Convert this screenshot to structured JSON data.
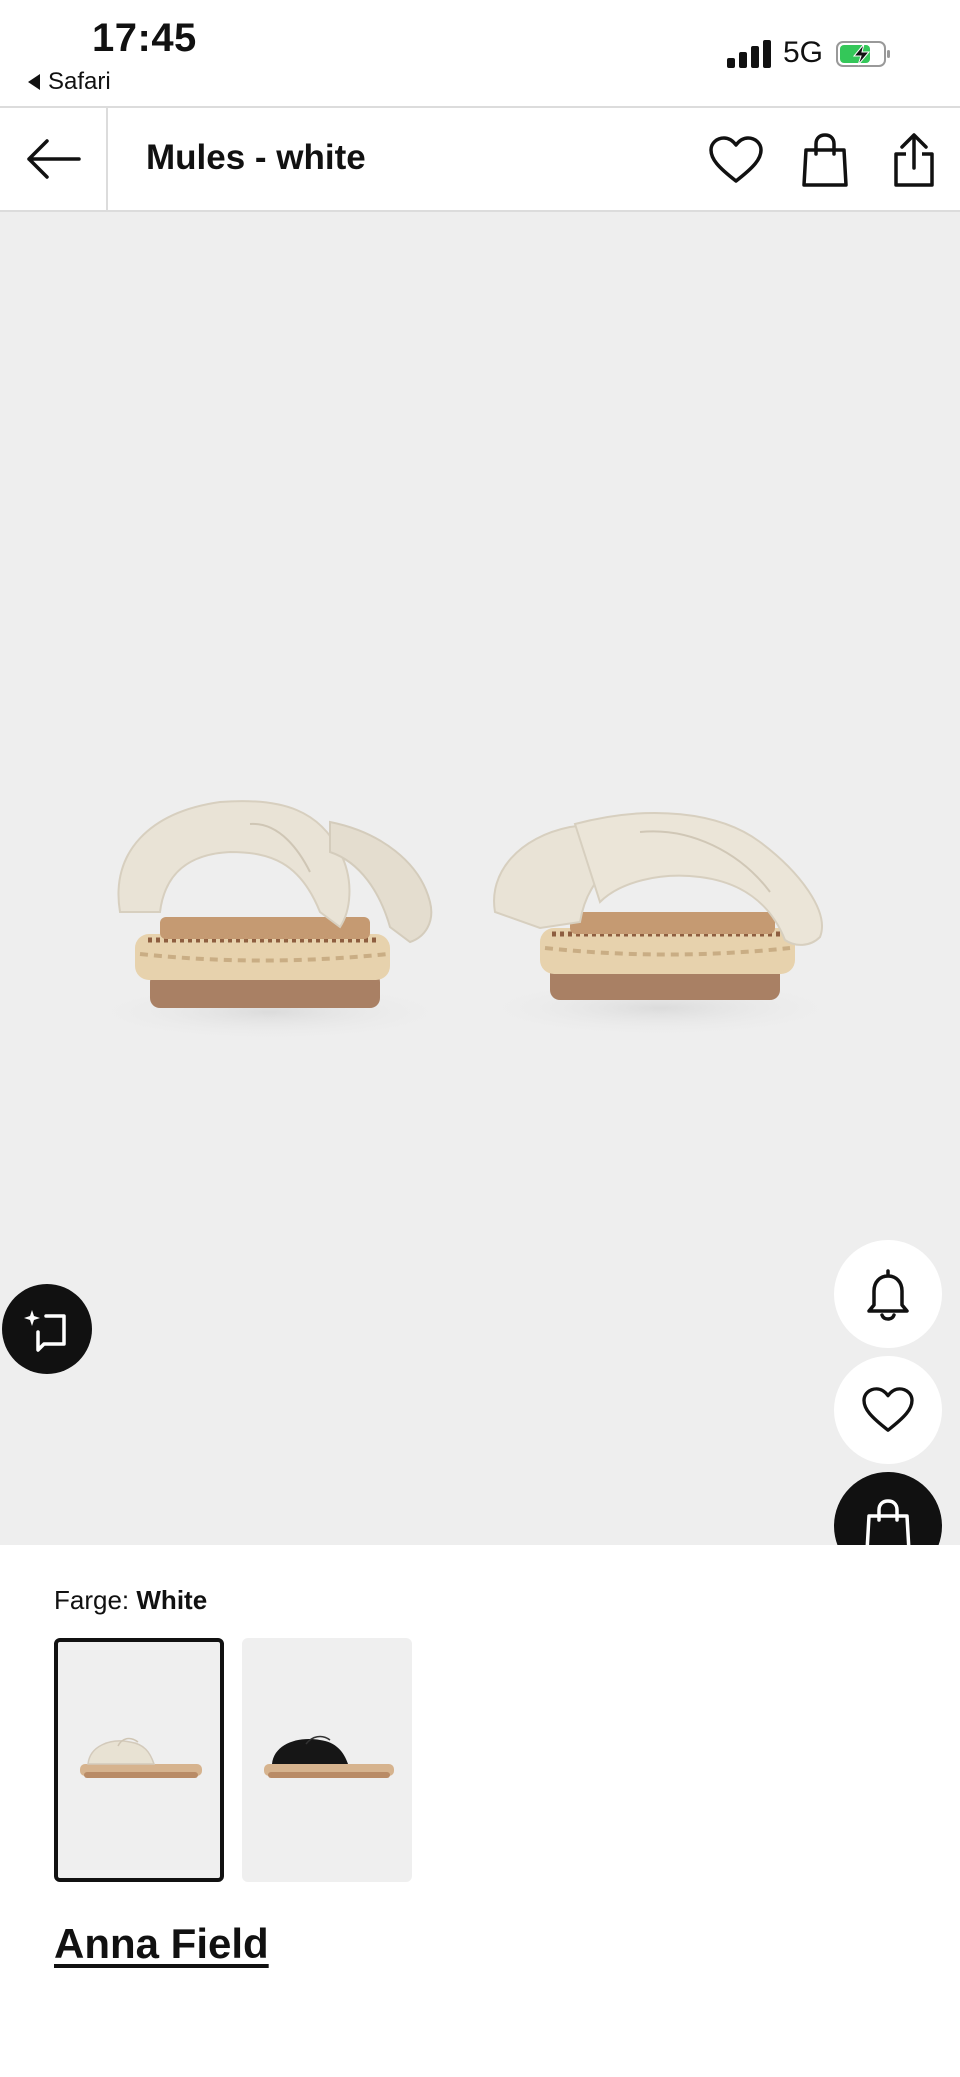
{
  "status_bar": {
    "time": "17:45",
    "back_app": "Safari",
    "network": "5G",
    "icons": [
      "signal-icon",
      "battery-charging-icon"
    ]
  },
  "header": {
    "title": "Mules - white",
    "icons": [
      "back-arrow-icon",
      "heart-icon",
      "shopping-bag-icon",
      "share-icon"
    ]
  },
  "gallery": {
    "image": "product-photo-white-espadrille-mules",
    "floating_buttons": [
      "ai-assist-icon",
      "bell-icon",
      "heart-icon",
      "shopping-bag-icon"
    ]
  },
  "product": {
    "color_label": "Farge:",
    "color_value": "White",
    "swatches": [
      {
        "name": "White",
        "selected": true
      },
      {
        "name": "Black",
        "selected": false
      }
    ],
    "brand": "Anna Field"
  },
  "colors": {
    "background": "#eeeeee",
    "accent_dark": "#111111",
    "battery_green": "#34c759"
  }
}
